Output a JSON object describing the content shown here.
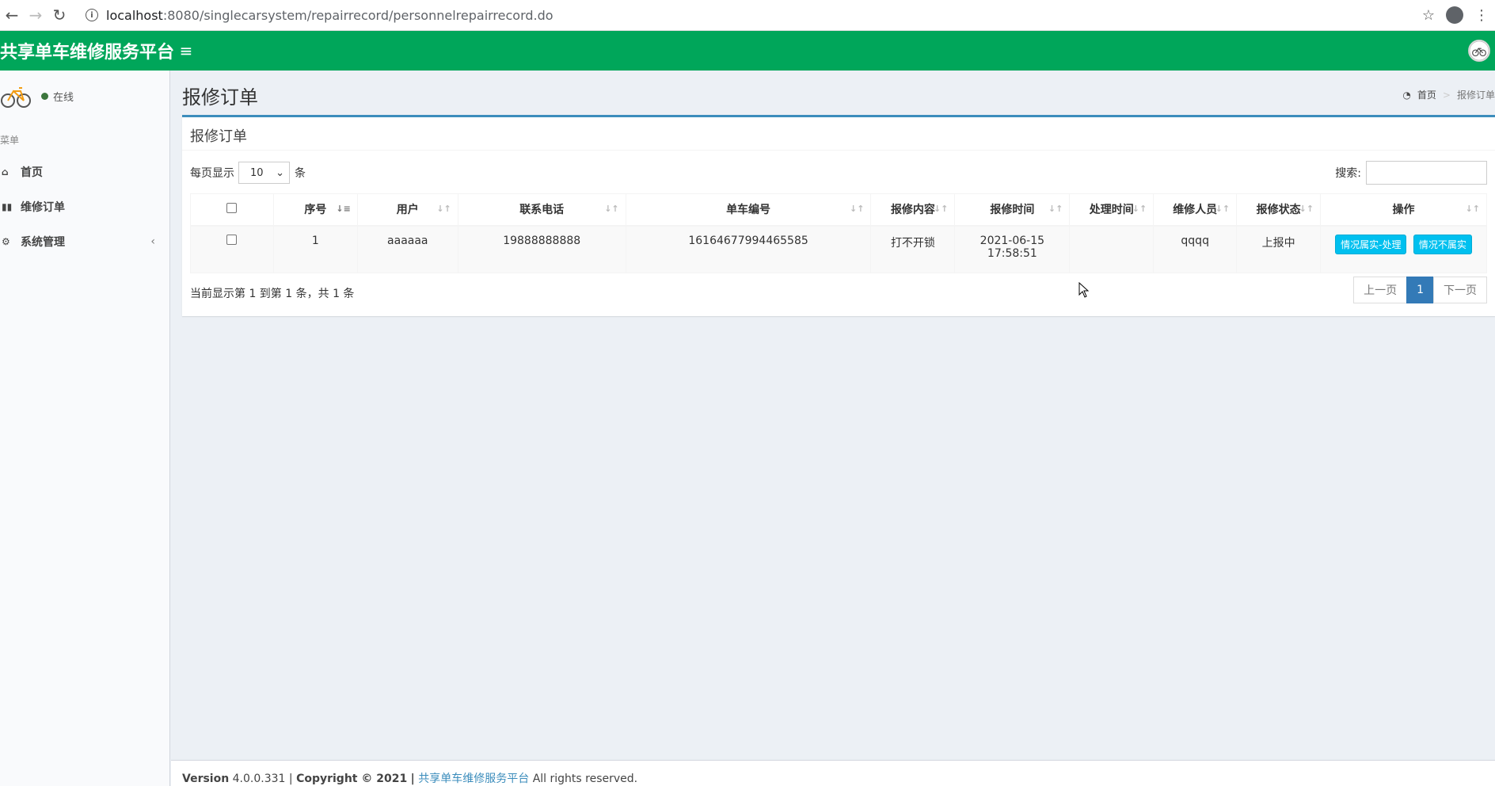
{
  "browser": {
    "back_icon": "arrow-left-icon",
    "forward_icon": "arrow-right-icon",
    "reload_icon": "reload-icon",
    "url_host": "localhost",
    "url_path": ":8080/singlecarsystem/repairrecord/personnelrepairrecord.do"
  },
  "header": {
    "logo": "共享单车维修服务平台",
    "toggle_icon": "hamburger-icon"
  },
  "sidebar": {
    "status": "在线",
    "menu_header": "菜单",
    "items": [
      {
        "label": "首页",
        "icon": "home-icon"
      },
      {
        "label": "维修订单",
        "icon": "bar-chart-icon"
      },
      {
        "label": "系统管理",
        "icon": "gear-icon"
      }
    ]
  },
  "page": {
    "title": "报修订单",
    "breadcrumb_home": "首页",
    "breadcrumb_current": "报修订单"
  },
  "box": {
    "title": "报修订单",
    "length_label_pre": "每页显示",
    "length_value": "10",
    "length_label_post": "条",
    "search_label": "搜索:",
    "search_value": ""
  },
  "table": {
    "columns": [
      "序号",
      "用户",
      "联系电话",
      "单车编号",
      "报修内容",
      "报修时间",
      "处理时间",
      "维修人员",
      "报修状态",
      "操作"
    ],
    "rows": [
      {
        "index": "1",
        "user": "aaaaaa",
        "phone": "19888888888",
        "bike_no": "16164677994465585",
        "content": "打不开锁",
        "report_time_date": "2021-06-15",
        "report_time_clock": "17:58:51",
        "handle_time": "",
        "repairer": "qqqq",
        "status": "上报中",
        "action_true": "情况属实-处理",
        "action_false": "情况不属实"
      }
    ]
  },
  "info": "当前显示第 1 到第 1 条，共 1 条",
  "pager": {
    "prev": "上一页",
    "current": "1",
    "next": "下一页"
  },
  "footer": {
    "version_label": "Version",
    "version": "4.0.0.331",
    "copyright": "Copyright © 2021",
    "brand": "共享单车维修服务平台",
    "rights": "All rights reserved."
  }
}
